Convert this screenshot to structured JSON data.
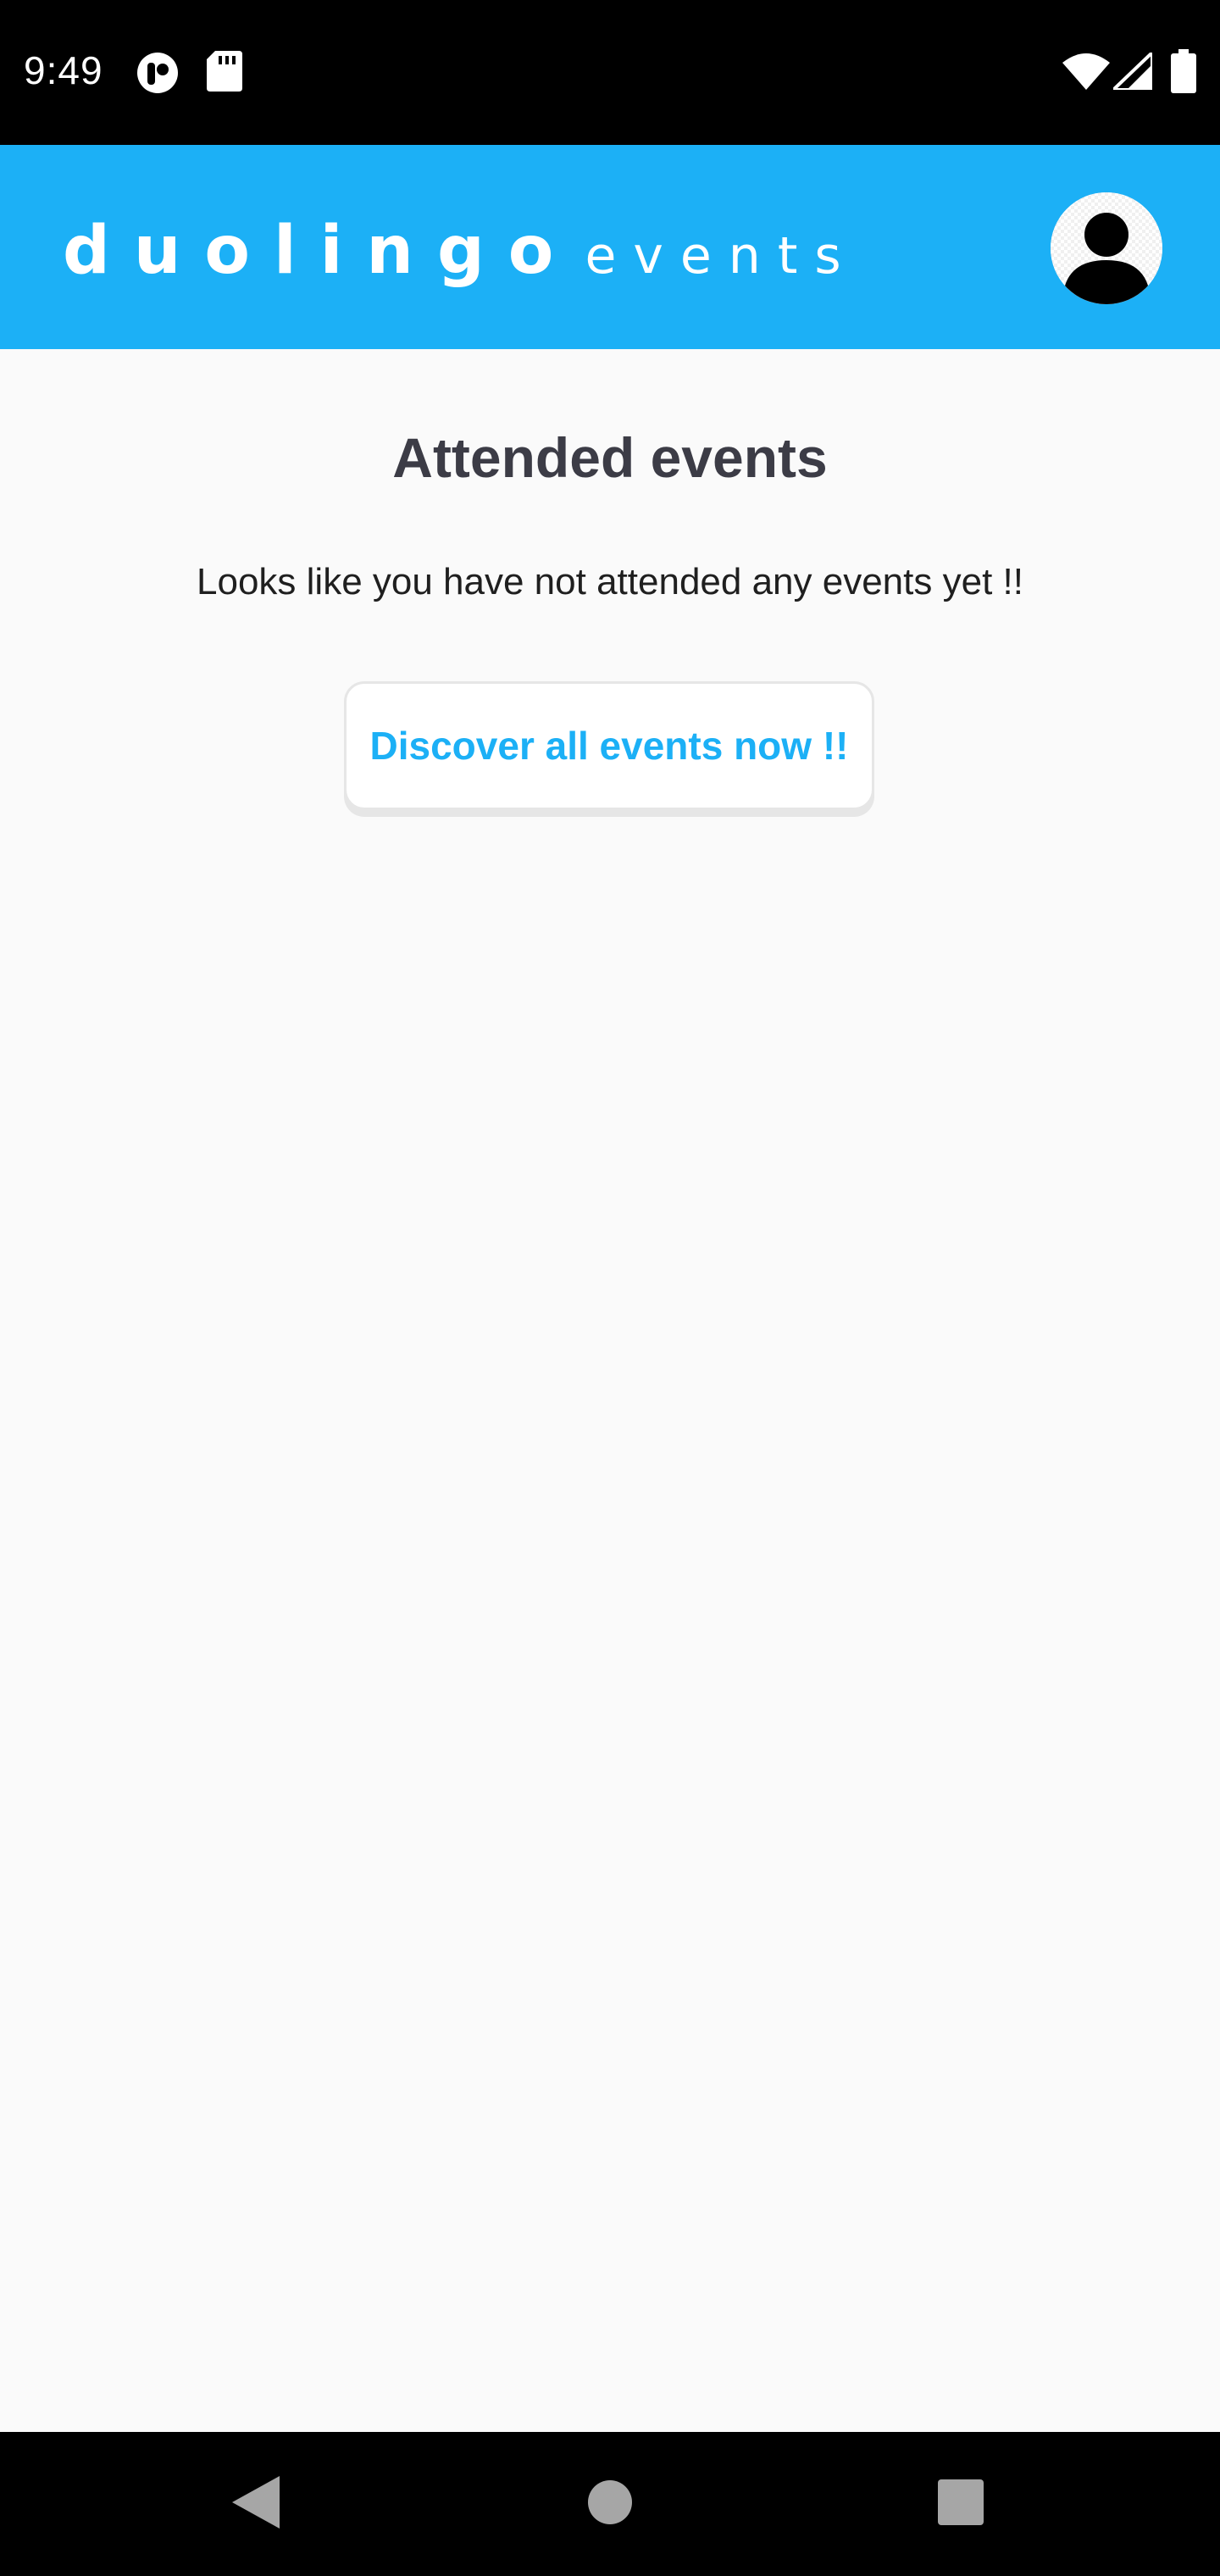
{
  "status_bar": {
    "time": "9:49",
    "left_icons": [
      "app-notification-icon",
      "sd-card-icon"
    ],
    "right_icons": [
      "wifi-icon",
      "cell-signal-icon",
      "battery-icon"
    ]
  },
  "app_bar": {
    "logo_main": "duolingo",
    "logo_sub": "events",
    "avatar_icon": "profile-avatar-icon",
    "brand_color": "#1cb0f6"
  },
  "main": {
    "title": "Attended events",
    "empty_message": "Looks like you have not attended any events yet !!",
    "discover_button_label": "Discover all events now !!"
  },
  "nav_bar": {
    "icons": [
      "back-icon",
      "home-icon",
      "recents-icon"
    ]
  }
}
